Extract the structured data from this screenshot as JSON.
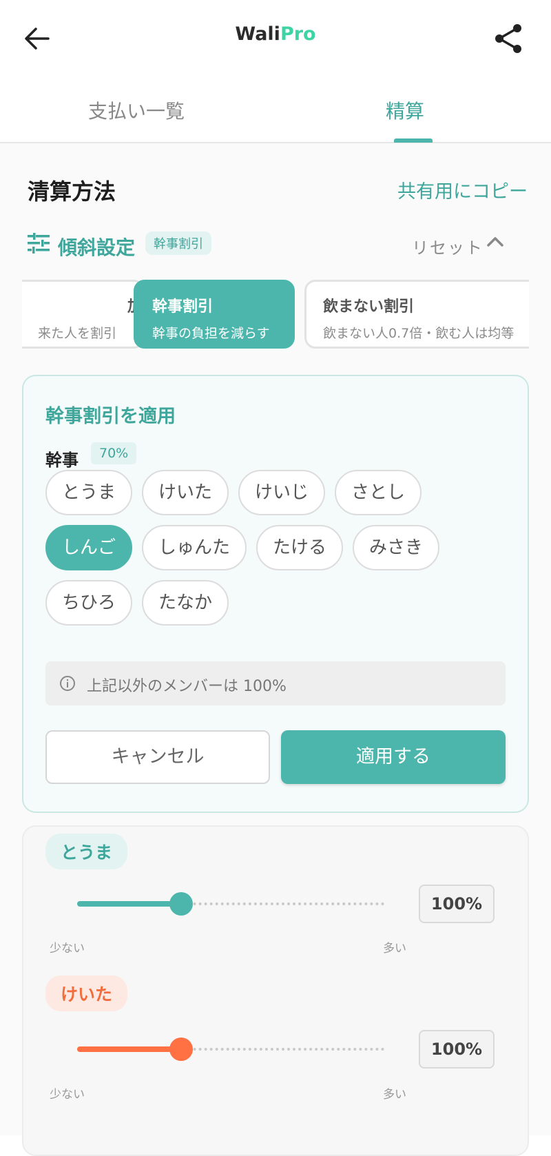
{
  "header": {
    "logo_text_1": "Wali",
    "logo_text_2": "Pro"
  },
  "tabs": [
    {
      "label": "支払い一覧",
      "active": false
    },
    {
      "label": "精算",
      "active": true
    }
  ],
  "section": {
    "title": "清算方法",
    "copy_label": "共有用にコピー"
  },
  "incline": {
    "label": "傾斜設定",
    "current_badge": "幹事割引",
    "reset_label": "リセット"
  },
  "presets": [
    {
      "title": "加",
      "subtitle": "来た人を割引"
    },
    {
      "title": "幹事割引",
      "subtitle": "幹事の負担を減らす",
      "active": true
    },
    {
      "title": "飲まない割引",
      "subtitle": "飲まない人0.7倍・飲む人は均等"
    }
  ],
  "apply_panel": {
    "title": "幹事割引を適用",
    "role_label": "幹事",
    "role_percent": "70%",
    "members": [
      "とうま",
      "けいた",
      "けいじ",
      "さとし",
      "しんご",
      "しゅんた",
      "たける",
      "みさき",
      "ちひろ",
      "たなか"
    ],
    "selected_member": "しんご",
    "info_text": "上記以外のメンバーは 100%",
    "cancel_label": "キャンセル",
    "apply_label": "適用する"
  },
  "member_sliders": [
    {
      "name": "とうま",
      "value_label": "100%",
      "value": 0.34,
      "color": "#4db6ac",
      "bg": "#e3f3f1",
      "text_color": "#3fa69c"
    },
    {
      "name": "けいた",
      "value_label": "100%",
      "value": 0.34,
      "color": "#ff7043",
      "bg": "#fde9e2",
      "text_color": "#f26d3d"
    }
  ],
  "scale": {
    "min_label": "少ない",
    "max_label": "多い"
  },
  "colors": {
    "accent": "#4db6ac",
    "accent_text": "#3fa69c"
  }
}
